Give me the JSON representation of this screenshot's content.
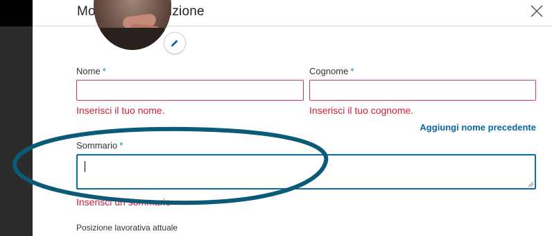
{
  "dialog": {
    "title": "Modifica introduzione",
    "close_icon": "close-icon",
    "edit_photo_icon": "pencil-icon"
  },
  "form": {
    "first_name": {
      "label": "Nome",
      "required_mark": "*",
      "value": "",
      "error": "Inserisci il tuo nome."
    },
    "last_name": {
      "label": "Cognome",
      "required_mark": "*",
      "value": "",
      "error": "Inserisci il tuo cognome."
    },
    "add_previous_name_link": "Aggiungi nome precedente",
    "summary": {
      "label": "Sommario",
      "required_mark": "*",
      "value": "",
      "error": "Inserisci un sommario"
    },
    "current_position": {
      "label": "Posizione lavorativa attuale"
    }
  },
  "colors": {
    "accent": "#0a66a3",
    "error": "#cc1f3b",
    "error_border": "#cc3855",
    "annotation_stroke": "#0b5a78"
  }
}
